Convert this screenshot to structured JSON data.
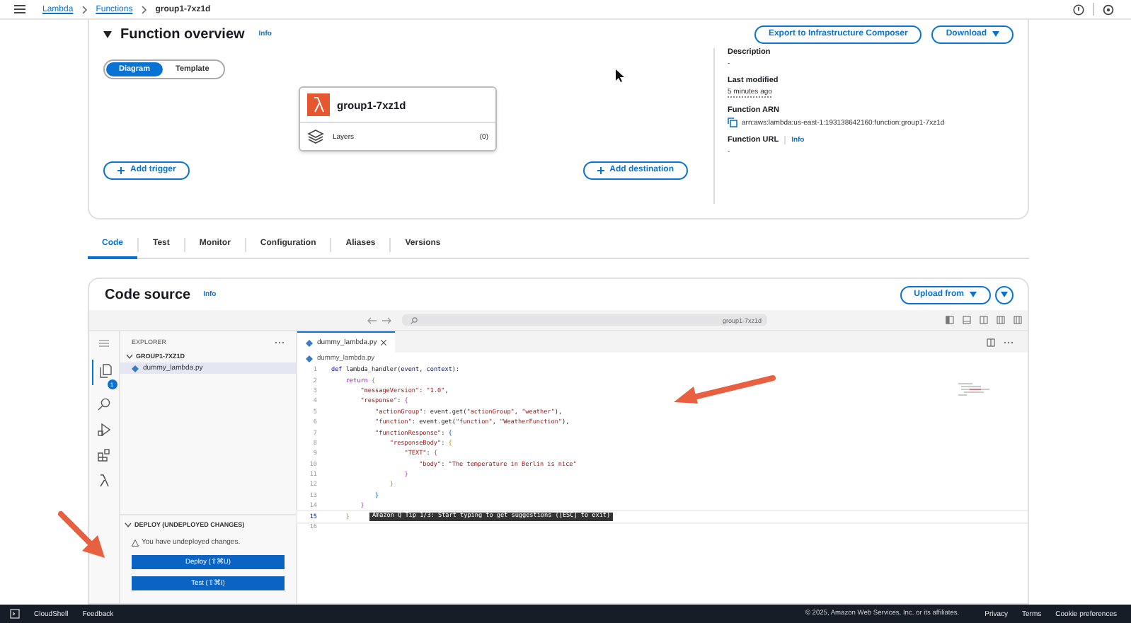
{
  "top_bar": {
    "breadcrumbs": [
      {
        "label": "Lambda",
        "link": true
      },
      {
        "label": "Functions",
        "link": true
      },
      {
        "label": "group1-7xz1d",
        "link": false
      }
    ]
  },
  "function_overview": {
    "title": "Function overview",
    "info": "Info",
    "buttons": [
      {
        "label": "Export to Infrastructure Composer",
        "dropdown": false
      },
      {
        "label": "Download",
        "dropdown": true
      }
    ],
    "view_toggle": [
      {
        "label": "Diagram",
        "selected": true
      },
      {
        "label": "Template",
        "selected": false
      }
    ],
    "function_node": {
      "name": "group1-7xz1d",
      "layers_label": "Layers",
      "layers_count": "(0)"
    },
    "add_trigger": "Add trigger",
    "add_destination": "Add destination",
    "details": [
      {
        "label": "Description",
        "value": "-",
        "kind": "plain"
      },
      {
        "label": "Last modified",
        "value": "5 minutes ago",
        "kind": "time"
      },
      {
        "label": "Function ARN",
        "value": "arn:aws:lambda:us-east-1:193138642160:function:group1-7xz1d",
        "kind": "copyable"
      },
      {
        "label": "Function URL",
        "info": "Info",
        "value": "-",
        "kind": "plain"
      }
    ]
  },
  "tabs": [
    {
      "label": "Code",
      "selected": true
    },
    {
      "label": "Test",
      "selected": false
    },
    {
      "label": "Monitor",
      "selected": false
    },
    {
      "label": "Configuration",
      "selected": false
    },
    {
      "label": "Aliases",
      "selected": false
    },
    {
      "label": "Versions",
      "selected": false
    }
  ],
  "code_source": {
    "title": "Code source",
    "info": "Info",
    "upload_button": "Upload from",
    "search_value": "group1-7xz1d",
    "files_badge": "1",
    "explorer": {
      "title": "EXPLORER",
      "folder": "GROUP1-7XZ1D",
      "expanded": true,
      "files": [
        {
          "name": "dummy_lambda.py",
          "selected": true
        }
      ]
    },
    "deploy": {
      "title": "DEPLOY (UNDEPLOYED CHANGES)",
      "expanded": true,
      "warning": "You have undeployed changes.",
      "buttons": [
        "Deploy (⇧⌘U)",
        "Test (⇧⌘I)"
      ]
    },
    "editor": {
      "tab": "dummy_lambda.py",
      "breadcrumb": "dummy_lambda.py",
      "tip": "Amazon Q Tip 1/3: Start typing to get suggestions ([ESC] to exit)",
      "lines": [
        {
          "number": "1",
          "active": false,
          "tokens": [
            {
              "kind": "keyword",
              "text": "def"
            },
            {
              "kind": "plain",
              "text": " lambda_handler("
            },
            {
              "kind": "param",
              "text": "event"
            },
            {
              "kind": "plain",
              "text": ", "
            },
            {
              "kind": "param",
              "text": "context"
            },
            {
              "kind": "plain",
              "text": "):"
            }
          ]
        },
        {
          "number": "2",
          "active": false,
          "tokens": [
            {
              "kind": "control",
              "text": "    return "
            },
            {
              "kind": "bracket1",
              "text": "{"
            }
          ]
        },
        {
          "number": "3",
          "active": false,
          "tokens": [
            {
              "kind": "string",
              "text": "        \"messageVersion\""
            },
            {
              "kind": "plain",
              "text": ": "
            },
            {
              "kind": "string",
              "text": "\"1.0\""
            },
            {
              "kind": "plain",
              "text": ","
            }
          ]
        },
        {
          "number": "4",
          "active": false,
          "tokens": [
            {
              "kind": "string",
              "text": "        \"response\""
            },
            {
              "kind": "plain",
              "text": ": "
            },
            {
              "kind": "bracket2",
              "text": "{"
            }
          ]
        },
        {
          "number": "5",
          "active": false,
          "tokens": [
            {
              "kind": "string",
              "text": "            \"actionGroup\""
            },
            {
              "kind": "plain",
              "text": ": event.get("
            },
            {
              "kind": "string",
              "text": "\"actionGroup\""
            },
            {
              "kind": "plain",
              "text": ", "
            },
            {
              "kind": "string",
              "text": "\"weather\""
            },
            {
              "kind": "plain",
              "text": "),"
            }
          ]
        },
        {
          "number": "6",
          "active": false,
          "tokens": [
            {
              "kind": "string",
              "text": "            \"function\""
            },
            {
              "kind": "plain",
              "text": ": event.get("
            },
            {
              "kind": "string",
              "text": "\"function\""
            },
            {
              "kind": "plain",
              "text": ", "
            },
            {
              "kind": "string",
              "text": "\"WeatherFunction\""
            },
            {
              "kind": "plain",
              "text": "),"
            }
          ]
        },
        {
          "number": "7",
          "active": false,
          "tokens": [
            {
              "kind": "string",
              "text": "            \"functionResponse\""
            },
            {
              "kind": "plain",
              "text": ": "
            },
            {
              "kind": "bracket3",
              "text": "{"
            }
          ]
        },
        {
          "number": "8",
          "active": false,
          "tokens": [
            {
              "kind": "string",
              "text": "                \"responseBody\""
            },
            {
              "kind": "plain",
              "text": ": "
            },
            {
              "kind": "bracket1",
              "text": "{"
            }
          ]
        },
        {
          "number": "9",
          "active": false,
          "tokens": [
            {
              "kind": "string",
              "text": "                    \"TEXT\""
            },
            {
              "kind": "plain",
              "text": ": "
            },
            {
              "kind": "bracket2",
              "text": "{"
            }
          ]
        },
        {
          "number": "10",
          "active": false,
          "tokens": [
            {
              "kind": "string",
              "text": "                        \"body\""
            },
            {
              "kind": "plain",
              "text": ": "
            },
            {
              "kind": "string",
              "text": "\"The temperature in Berlin is nice\""
            }
          ]
        },
        {
          "number": "11",
          "active": false,
          "tokens": [
            {
              "kind": "bracket2",
              "text": "                    }"
            }
          ]
        },
        {
          "number": "12",
          "active": false,
          "tokens": [
            {
              "kind": "bracket1",
              "text": "                }"
            }
          ]
        },
        {
          "number": "13",
          "active": false,
          "tokens": [
            {
              "kind": "bracket3",
              "text": "            }"
            }
          ]
        },
        {
          "number": "14",
          "active": false,
          "tokens": [
            {
              "kind": "bracket2",
              "text": "        }"
            }
          ]
        },
        {
          "number": "15",
          "active": true,
          "tokens": [
            {
              "kind": "bracket1",
              "text": "    }"
            }
          ]
        },
        {
          "number": "16",
          "active": false
        }
      ]
    }
  },
  "footer": {
    "left": [
      "CloudShell",
      "Feedback"
    ],
    "copyright": "© 2025, Amazon Web Services, Inc. or its affiliates.",
    "links": [
      "Privacy",
      "Terms",
      "Cookie preferences"
    ]
  }
}
